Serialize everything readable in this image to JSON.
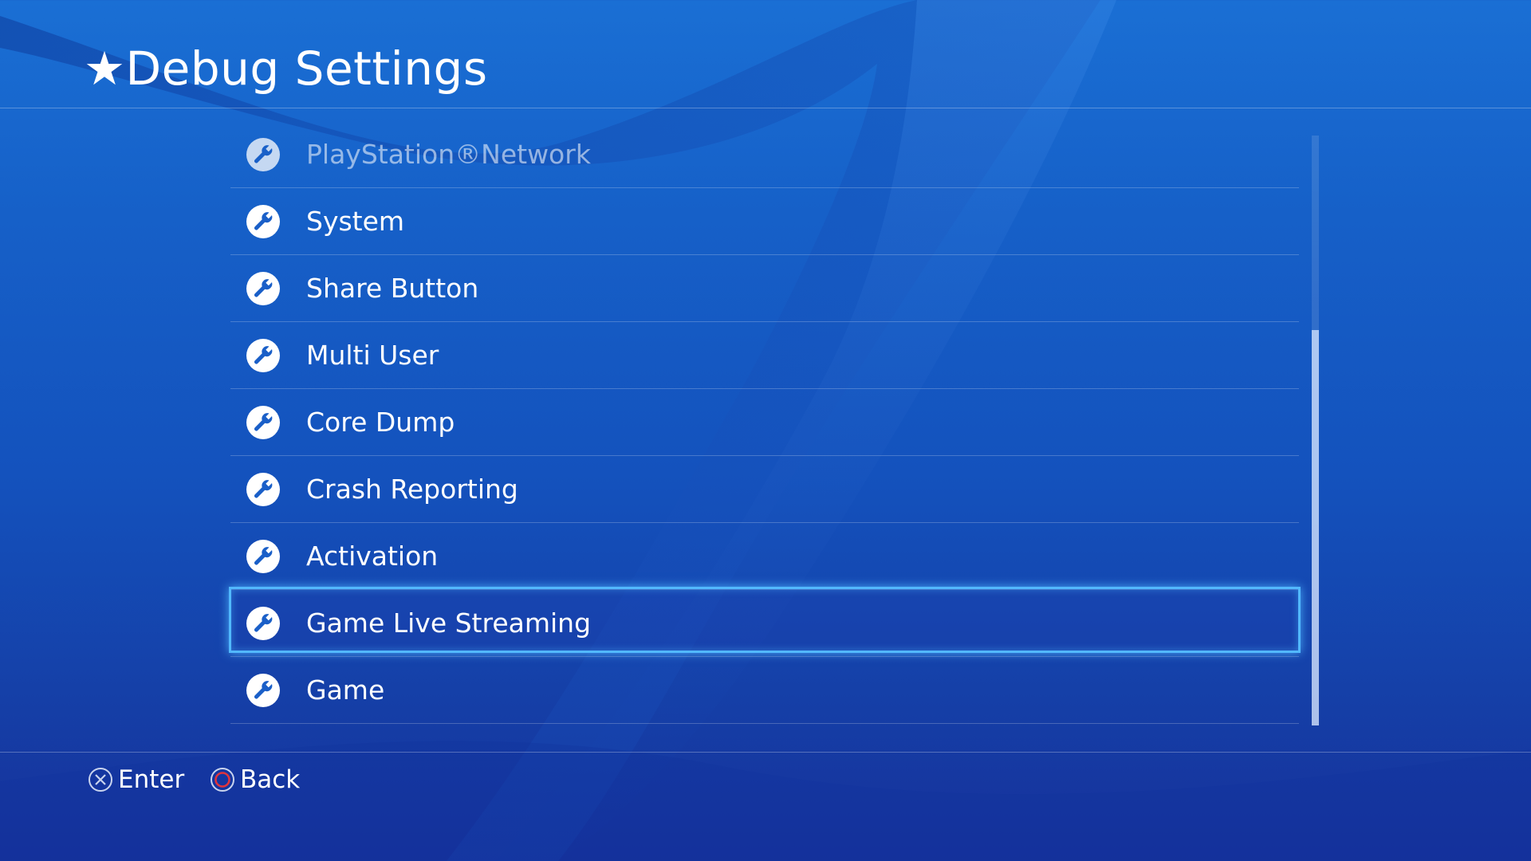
{
  "header": {
    "title": "★Debug Settings"
  },
  "menu": {
    "items": [
      {
        "label": "PlayStation®Network",
        "icon": "wrench-icon",
        "state": "faded"
      },
      {
        "label": "System",
        "icon": "wrench-icon",
        "state": "normal"
      },
      {
        "label": "Share Button",
        "icon": "wrench-icon",
        "state": "normal"
      },
      {
        "label": "Multi User",
        "icon": "wrench-icon",
        "state": "normal"
      },
      {
        "label": "Core Dump",
        "icon": "wrench-icon",
        "state": "normal"
      },
      {
        "label": "Crash Reporting",
        "icon": "wrench-icon",
        "state": "normal"
      },
      {
        "label": "Activation",
        "icon": "wrench-icon",
        "state": "normal"
      },
      {
        "label": "Game Live Streaming",
        "icon": "wrench-icon",
        "state": "selected"
      },
      {
        "label": "Game",
        "icon": "wrench-icon",
        "state": "normal"
      }
    ],
    "scroll_position": 0.33,
    "scroll_visible_fraction": 0.67
  },
  "footer": {
    "enter_label": "Enter",
    "enter_icon": "cross-button-icon",
    "back_label": "Back",
    "back_icon": "circle-button-icon"
  },
  "colors": {
    "selection_border": "#52b8ff",
    "circle_button": "#e0343c",
    "background": "#1660c8"
  }
}
